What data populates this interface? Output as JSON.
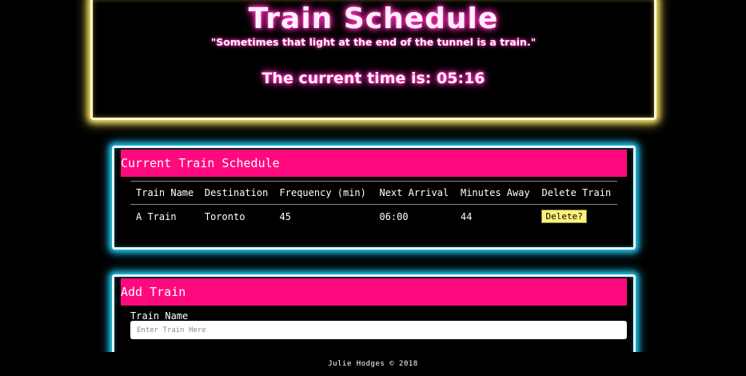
{
  "header": {
    "title": "Train Schedule",
    "quote": "\"Sometimes that light at the end of the tunnel is a train.\"",
    "time_label": "The current time is: 05:16"
  },
  "schedule": {
    "heading": "Current Train Schedule",
    "columns": [
      "Train Name",
      "Destination",
      "Frequency (min)",
      "Next Arrival",
      "Minutes Away",
      "Delete Train"
    ],
    "rows": [
      {
        "name": "A Train",
        "destination": "Toronto",
        "frequency": "45",
        "next_arrival": "06:00",
        "minutes_away": "44",
        "delete_label": "Delete?"
      }
    ]
  },
  "add_train": {
    "heading": "Add Train",
    "name_label": "Train Name",
    "name_placeholder": "Enter Train Here"
  },
  "footer": {
    "text": "Julie Hodges © 2018"
  },
  "colors": {
    "header_glow": "#ffe96a",
    "card_glow": "#22c8f0",
    "card_header_bg": "#ff0a7e",
    "text_glow": "#ff2fb8",
    "button_bg": "#fff27a"
  }
}
